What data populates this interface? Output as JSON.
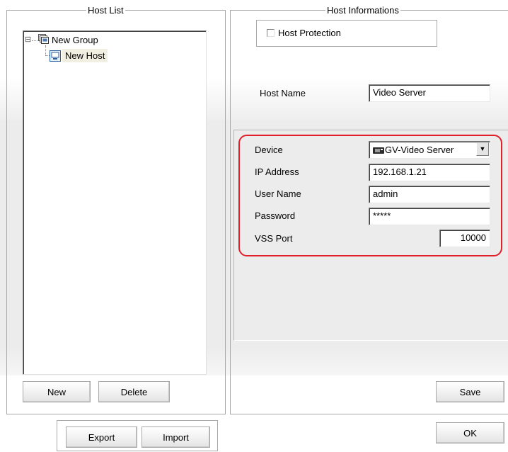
{
  "host_list": {
    "title": "Host List",
    "tree": {
      "expander": "⊟",
      "group_label": "New Group",
      "host_label": "New Host"
    },
    "new_button": "New",
    "delete_button": "Delete"
  },
  "export_button": "Export",
  "import_button": "Import",
  "host_info": {
    "title": "Host Informations",
    "protection_label": "Host Protection",
    "protection_checked": false,
    "host_name_label": "Host Name",
    "host_name_value": "Video Server",
    "device_label": "Device",
    "device_value": "GV-Video Server",
    "dropdown_arrow": "▼",
    "ip_label": "IP Address",
    "ip_value": "192.168.1.21",
    "user_label": "User Name",
    "user_value": "admin",
    "password_label": "Password",
    "password_value": "*****",
    "port_label": "VSS Port",
    "port_value": "10000",
    "save_button": "Save"
  },
  "ok_button": "OK",
  "colors": {
    "highlight_outline": "#e0202a",
    "panel_gray": "#ececec",
    "selected_item_bg": "#f1efe2"
  }
}
